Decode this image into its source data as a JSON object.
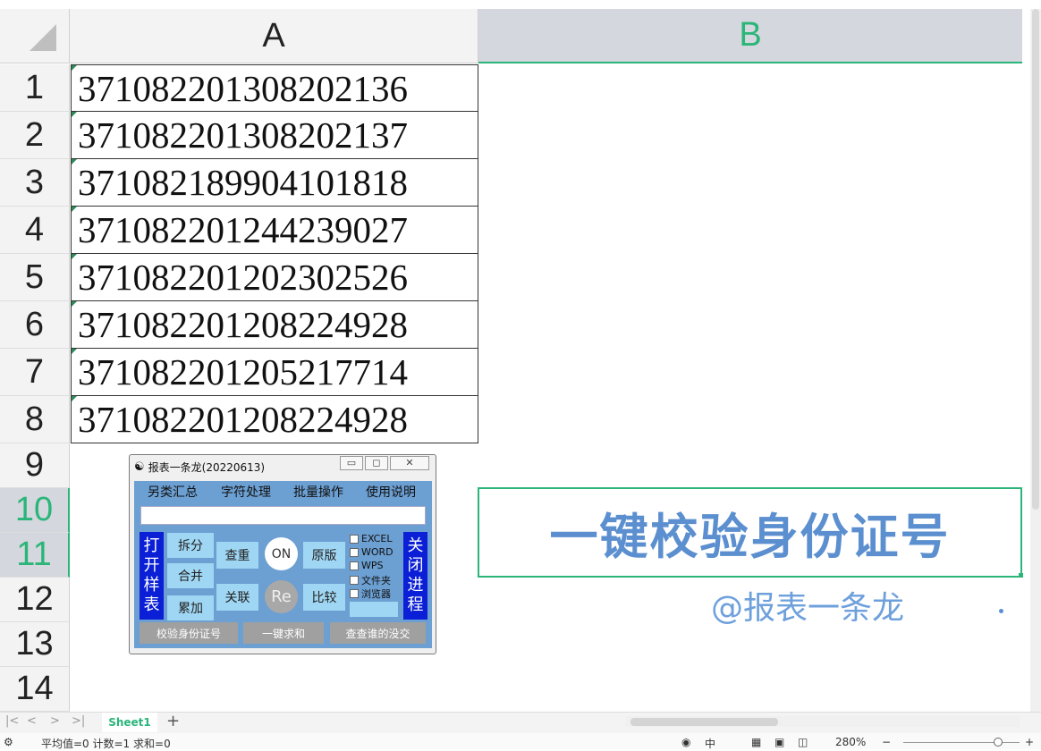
{
  "columns": [
    "A",
    "B"
  ],
  "rows": [
    "1",
    "2",
    "3",
    "4",
    "5",
    "6",
    "7",
    "8",
    "9",
    "10",
    "11",
    "12",
    "13",
    "14"
  ],
  "cells_a": [
    "371082201308202136",
    "371082201308202137",
    "371082189904101818",
    "371082201244239027",
    "371082201202302526",
    "371082201208224928",
    "371082201205217714",
    "371082201208224928"
  ],
  "dialog": {
    "title": "报表一条龙(20220613)",
    "menus": [
      "另类汇总",
      "字符处理",
      "批量操作",
      "使用说明"
    ],
    "left_bar": "打开样表",
    "right_bar": "关闭进程",
    "buttons": {
      "split": "拆分",
      "merge": "合并",
      "accumulate": "累加",
      "lookup": "查重",
      "relate": "关联",
      "on": "ON",
      "re": "Re",
      "original": "原版",
      "compare": "比较"
    },
    "checkboxes": [
      "EXCEL",
      "WORD",
      "WPS",
      "文件夹",
      "浏览器"
    ],
    "bottom_buttons": [
      "校验身份证号",
      "一键求和",
      "查查谁的没交"
    ]
  },
  "banner": {
    "text": "一键校验身份证号",
    "credit": "@报表一条龙"
  },
  "sheet_tab": "Sheet1",
  "status": {
    "summary": "平均值=0  计数=1  求和=0",
    "input_mode": "中",
    "zoom": "280%"
  }
}
